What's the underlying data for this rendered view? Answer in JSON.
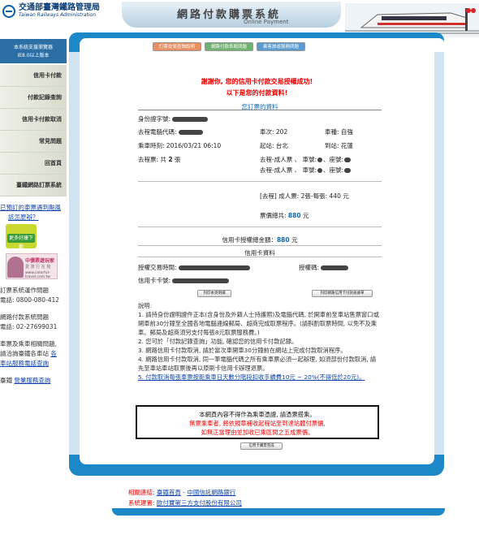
{
  "header": {
    "logo_zh": "交通部臺灣鐵路管理局",
    "logo_en": "Taiwan Railways Administration",
    "title_zh": "網路付款購票系統",
    "title_en": "Online Payment"
  },
  "sidebar": {
    "top_line1": "本系統支援瀏覽器",
    "top_line2": "IE8.0以上版本",
    "items": [
      {
        "label": "信用卡付款"
      },
      {
        "label": "付款記錄查詢"
      },
      {
        "label": "信用卡付款取消"
      },
      {
        "label": "常見問題"
      },
      {
        "label": "回首頁"
      },
      {
        "label": "臺鐵網路訂票系統"
      }
    ],
    "typhoon_link_l1": "已預訂的車票遇到颱風",
    "typhoon_link_l2": "該怎麼辦？",
    "banner1_label": "更多好康下載",
    "banner2_title": "中債票遊玩家",
    "banner2_sub": "愛 旅 行 在 我",
    "banner2_url": "www.colorful-travel.com.tw",
    "ops_title": "訂票系統運作問題",
    "ops_phone": "電話: 0800-080-412",
    "pay_title": "網路付款系統問題",
    "pay_phone": "電話: 02-27699031",
    "station_l1": "車票及乘車相關問題,",
    "station_l2a": "請洽詢臺鐵各車站",
    "station_l2b": "各",
    "station_l3": "車站服務電話查詢",
    "complaint_label": "臺鐵",
    "complaint_link": "營業服務查詢"
  },
  "tabs": [
    {
      "label": "訂票交易查詢說明"
    },
    {
      "label": "網路付款系統問題"
    },
    {
      "label": "乘客旅遊服務問題"
    }
  ],
  "main": {
    "success_line1": "謝謝你, 您的信用卡付款交易授權成功!",
    "success_line2": "以下是您的付款資料!",
    "ticket_section": "您訂票的資料",
    "id_label": "身份證字號:",
    "pc_code_label": "去程電腦代碼:",
    "train_no_label": "車次: 202",
    "train_type_label": "車種: 自強",
    "depart_time": "乘車時刻: 2016/03/21 06:10",
    "from_label": "起站: 台北",
    "to_label": "到站: 花蓮",
    "total_tickets_prefix": "去程票: 共",
    "total_tickets_count": "2",
    "total_tickets_suffix": "張",
    "seat1_prefix": "去程-成人票 、 車號:",
    "seat1_mid": "、座號:",
    "seat2_prefix": "去程-成人票 、 車號:",
    "seat2_mid": "、座號:",
    "fare_line": "[去程] 成人票: 2張-每張: 440 元",
    "fare_total_label": "票價總共:",
    "fare_total_value": "880",
    "fare_total_unit": "元",
    "auth_total_label": "信用卡授權總金額：",
    "auth_total_value": "880",
    "auth_total_unit": "元",
    "card_section": "信用卡資料",
    "auth_time_label": "授權交易時間:",
    "auth_code_label": "授權碼:",
    "card_no_label": "信用卡卡號:",
    "print_page_btn": "列印本頁明細",
    "print_receipt_btn": "列印網路信用卡付款收據單",
    "notes_title": "說明:",
    "notes": [
      "1. 請持身份證明證件正本(含身份及外籍人士持護照)及電腦代碼, 於開車前至車站售票窗口或開車前30分鐘至全國各地電腦連線郵局、超商完成取票程序。(請斟酌取票時間, 以免不及乘車。郵局及超商須另支付每張8元取票服務費。)",
      "2. 您可於「付款記錄查詢」功能, 確認您的信用卡付款記錄。",
      "3. 網路信用卡付款取消, 請於當次車開車30分鐘前在網站上完成付款取消程序。",
      "4. 網路信用卡付款取消, 同一筆電腦代碼之所有乘車票必須一起辦理, 如須部份付款取消, 請先至車站車站取票後再以原刷卡信用卡辦理退票。"
    ],
    "note5": "5. 付款取消每張車票按距乘車日天數分階段扣收手續費10元 ~ 20%(不得低於20元)。",
    "warn_line1": "本網頁內容不得作為乘車憑證, 請憑票搭乘。",
    "warn_line2": "無票乘車者, 將依規章補收起程站至到達站體付票價,",
    "warn_line3": "如無正當理由並加收已乘區間之五成票價。",
    "complete_btn": "信用卡購票完成"
  },
  "footer": {
    "related_label": "相關連結:",
    "related_link1": "臺鐵首頁",
    "related_sep": " - ",
    "related_link2": "中國信託網路銀行",
    "builder_label": "系統建置:",
    "builder_link": "歐付寶第三方支付股份有限公司"
  },
  "colors": {
    "frame_blue": "#1c88c8",
    "success_red": "#ee0000",
    "link_blue": "#1144aa"
  }
}
